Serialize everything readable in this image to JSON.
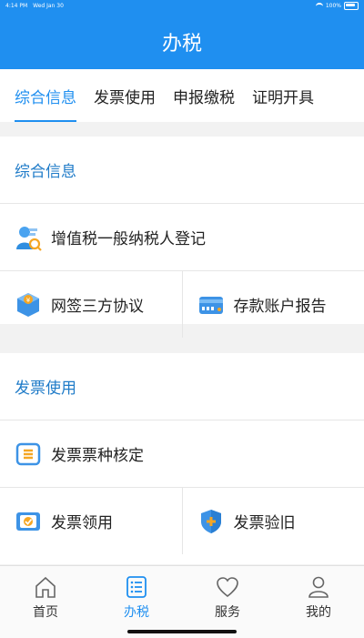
{
  "status": {
    "time": "4:14 PM",
    "date": "Wed Jan 30",
    "battery": "100%"
  },
  "header": {
    "title": "办税"
  },
  "tabs": [
    {
      "label": "综合信息",
      "active": true
    },
    {
      "label": "发票使用",
      "active": false
    },
    {
      "label": "申报缴税",
      "active": false
    },
    {
      "label": "证明开具",
      "active": false
    }
  ],
  "sections": [
    {
      "title": "综合信息",
      "items": [
        {
          "label": "增值税一般纳税人登记",
          "icon": "taxpayer-registration-icon"
        },
        {
          "label": "网签三方协议",
          "icon": "tripartite-agreement-icon"
        },
        {
          "label": "存款账户报告",
          "icon": "bank-card-icon"
        }
      ]
    },
    {
      "title": "发票使用",
      "items": [
        {
          "label": "发票票种核定",
          "icon": "invoice-type-icon"
        },
        {
          "label": "发票领用",
          "icon": "invoice-collect-icon"
        },
        {
          "label": "发票验旧",
          "icon": "invoice-verify-shield-icon"
        }
      ]
    }
  ],
  "bottom_nav": [
    {
      "label": "首页",
      "icon": "home-icon",
      "active": false
    },
    {
      "label": "办税",
      "icon": "list-icon",
      "active": true
    },
    {
      "label": "服务",
      "icon": "heart-icon",
      "active": false
    },
    {
      "label": "我的",
      "icon": "user-icon",
      "active": false
    }
  ],
  "colors": {
    "brand": "#1f8ff0",
    "accent_orange": "#f5a623"
  }
}
